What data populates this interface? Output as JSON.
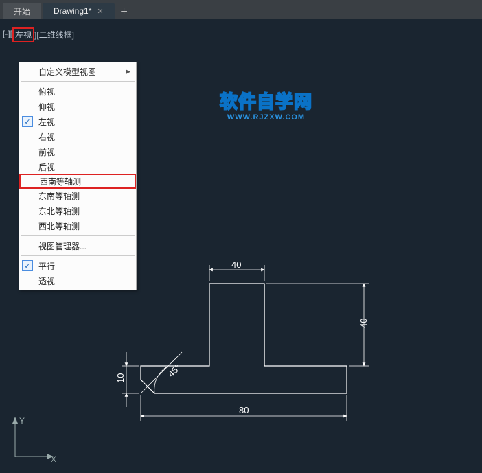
{
  "tabs": {
    "start": "开始",
    "drawing": "Drawing1*"
  },
  "viewport_label": {
    "prefix": "[-][",
    "view": "左视",
    "suffix": "][二维线框]"
  },
  "menu": {
    "custom_model_view": "自定义模型视图",
    "top": "俯视",
    "bottom": "仰视",
    "left": "左视",
    "right": "右视",
    "front": "前视",
    "back": "后视",
    "sw_iso": "西南等轴测",
    "se_iso": "东南等轴测",
    "ne_iso": "东北等轴测",
    "nw_iso": "西北等轴测",
    "view_manager": "视图管理器...",
    "parallel": "平行",
    "perspective": "透视"
  },
  "watermark": {
    "line1": "软件自学网",
    "line2": "WWW.RJZXW.COM"
  },
  "dimensions": {
    "top": "40",
    "right": "40",
    "left": "10",
    "angle": "45°",
    "bottom": "80"
  },
  "ucs": {
    "x": "X",
    "y": "Y"
  }
}
